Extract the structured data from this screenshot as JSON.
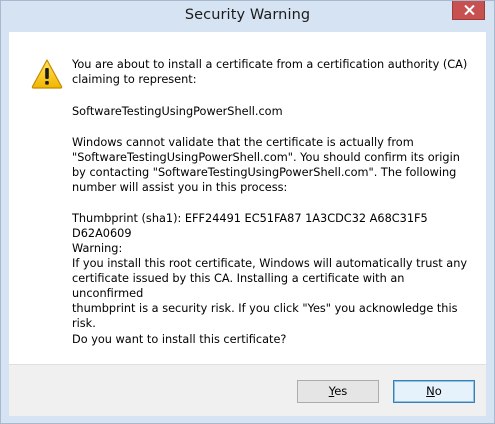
{
  "window": {
    "title": "Security Warning",
    "close_icon": "close-icon",
    "close_color": "#c75050"
  },
  "message": {
    "icon": "warning-icon",
    "para1": "You are about to install a certificate from a certification authority (CA)\nclaiming to represent:",
    "para2": "SoftwareTestingUsingPowerShell.com",
    "para3": "Windows cannot validate that the certificate is actually from\n\"SoftwareTestingUsingPowerShell.com\". You should confirm its origin\nby contacting \"SoftwareTestingUsingPowerShell.com\". The following\nnumber will assist you in this process:",
    "para4": "Thumbprint (sha1): EFF24491 EC51FA87 1A3CDC32 A68C31F5 D62A0609",
    "para5": "Warning:\nIf you install this root certificate, Windows will automatically trust any\ncertificate issued by this CA. Installing a certificate with an unconfirmed\nthumbprint is a security risk. If you click \"Yes\" you acknowledge this\nrisk.",
    "para6": "Do you want to install this certificate?"
  },
  "buttons": {
    "yes_mnemonic": "Y",
    "yes_rest": "es",
    "no_mnemonic": "N",
    "no_rest": "o"
  }
}
